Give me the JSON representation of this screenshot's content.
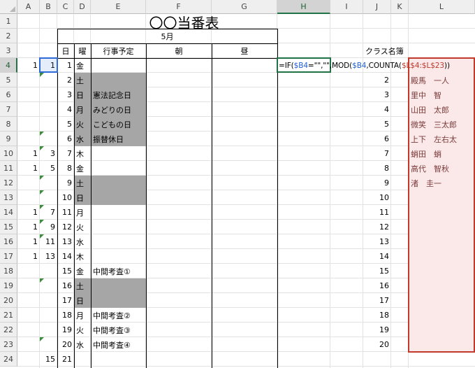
{
  "columns": [
    "A",
    "B",
    "C",
    "D",
    "E",
    "F",
    "G",
    "H",
    "I",
    "J",
    "K",
    "L"
  ],
  "rows": [
    "1",
    "2",
    "3",
    "4",
    "5",
    "6",
    "7",
    "8",
    "9",
    "10",
    "11",
    "12",
    "13",
    "14",
    "15",
    "16",
    "17",
    "18",
    "19",
    "20",
    "21",
    "22",
    "23",
    "24"
  ],
  "title": "〇〇当番表",
  "month": "5月",
  "headers": {
    "day": "日",
    "weekday": "曜",
    "event": "行事予定",
    "morning": "朝",
    "noon": "昼"
  },
  "class_list_label": "クラス名簿",
  "schedule": [
    {
      "a": "1",
      "b": "1",
      "day": "1",
      "wd": "金",
      "event": ""
    },
    {
      "a": "",
      "b": "",
      "day": "2",
      "wd": "土",
      "event": ""
    },
    {
      "a": "",
      "b": "",
      "day": "3",
      "wd": "日",
      "event": "憲法記念日"
    },
    {
      "a": "",
      "b": "",
      "day": "4",
      "wd": "月",
      "event": "みどりの日"
    },
    {
      "a": "",
      "b": "",
      "day": "5",
      "wd": "火",
      "event": "こどもの日"
    },
    {
      "a": "",
      "b": "",
      "day": "6",
      "wd": "水",
      "event": "振替休日"
    },
    {
      "a": "1",
      "b": "3",
      "day": "7",
      "wd": "木",
      "event": ""
    },
    {
      "a": "1",
      "b": "5",
      "day": "8",
      "wd": "金",
      "event": ""
    },
    {
      "a": "",
      "b": "",
      "day": "9",
      "wd": "土",
      "event": ""
    },
    {
      "a": "",
      "b": "",
      "day": "10",
      "wd": "日",
      "event": ""
    },
    {
      "a": "1",
      "b": "7",
      "day": "11",
      "wd": "月",
      "event": ""
    },
    {
      "a": "1",
      "b": "9",
      "day": "12",
      "wd": "火",
      "event": ""
    },
    {
      "a": "1",
      "b": "11",
      "day": "13",
      "wd": "水",
      "event": ""
    },
    {
      "a": "1",
      "b": "13",
      "day": "14",
      "wd": "木",
      "event": ""
    },
    {
      "a": "",
      "b": "",
      "day": "15",
      "wd": "金",
      "event": "中間考査①"
    },
    {
      "a": "",
      "b": "",
      "day": "16",
      "wd": "土",
      "event": ""
    },
    {
      "a": "",
      "b": "",
      "day": "17",
      "wd": "日",
      "event": ""
    },
    {
      "a": "",
      "b": "",
      "day": "18",
      "wd": "月",
      "event": "中間考査②"
    },
    {
      "a": "",
      "b": "",
      "day": "19",
      "wd": "火",
      "event": "中間考査③"
    },
    {
      "a": "",
      "b": "",
      "day": "20",
      "wd": "水",
      "event": "中間考査④"
    }
  ],
  "row24": {
    "b": "15",
    "day": "21"
  },
  "roster_numbers": [
    "1",
    "2",
    "3",
    "4",
    "5",
    "6",
    "7",
    "8",
    "9",
    "10",
    "11",
    "12",
    "13",
    "14",
    "15",
    "16",
    "17",
    "18",
    "19",
    "20"
  ],
  "roster_names": [
    "",
    "殿馬　一人",
    "里中　智",
    "山田　太郎",
    "微笑　三太郎",
    "上下　左右太",
    "蛸田　蛸",
    "高代　智秋",
    "渚　圭一"
  ],
  "formula": {
    "p1": "=IF(",
    "p2": "$B4",
    "p3": "=\"\",\"\",MOD(",
    "p4": "$B4",
    "p5": ",COUNTA(",
    "p6": "$L$4:$L$23",
    "p7": "))"
  },
  "colors": {
    "header_bg": "#efefef",
    "active_green": "#217346",
    "holiday_gray": "#a6a6a6",
    "range_red": "#c0392b",
    "range_fill": "#fbe9e9",
    "selection_blue": "#2e6bd8"
  }
}
